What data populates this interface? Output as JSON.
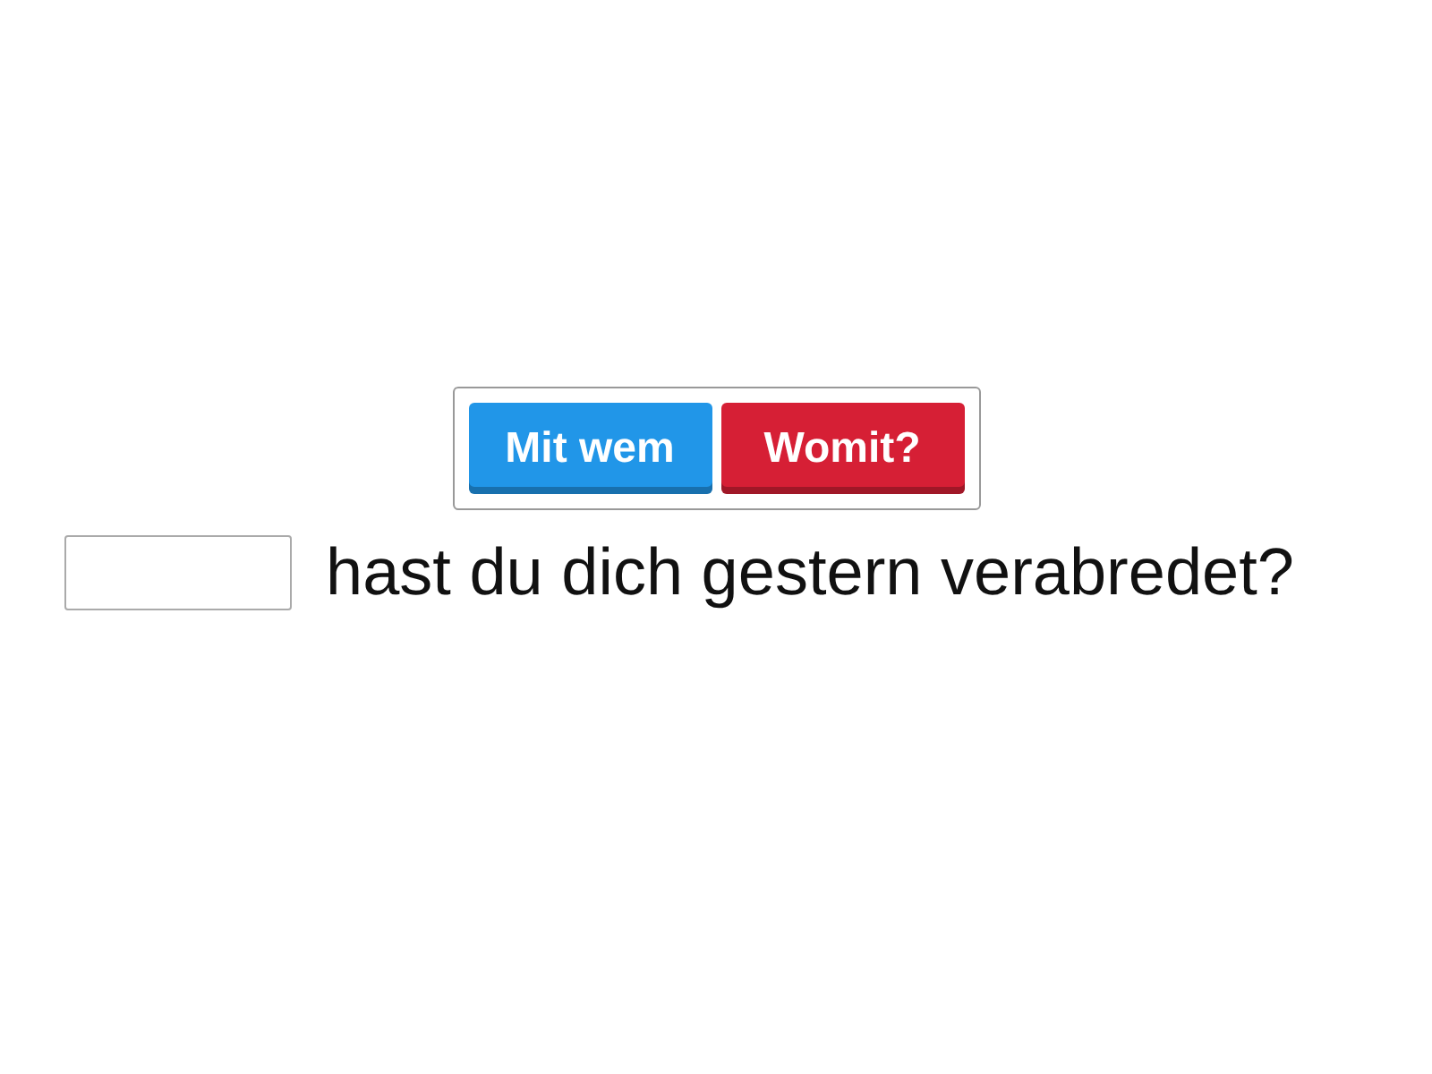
{
  "choices": [
    {
      "label": "Mit wem",
      "color": "#2196e8"
    },
    {
      "label": "Womit?",
      "color": "#d61f35"
    }
  ],
  "sentence": {
    "text": "hast du dich gestern verabredet?"
  }
}
